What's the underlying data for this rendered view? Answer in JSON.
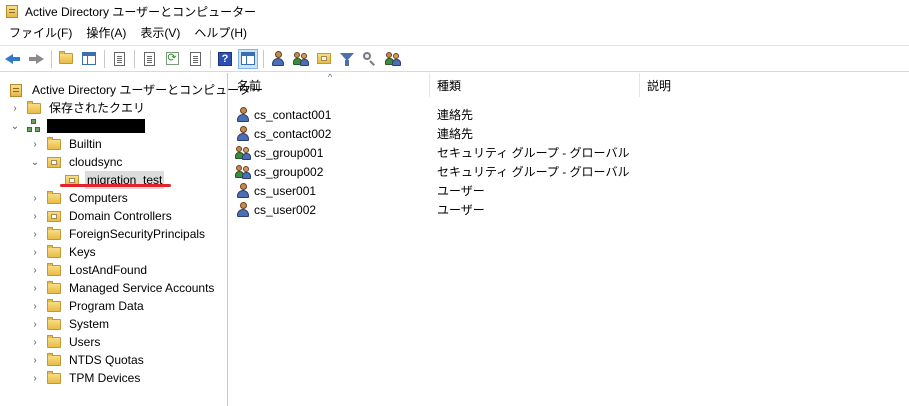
{
  "window": {
    "title": "Active Directory ユーザーとコンピューター"
  },
  "menu": [
    "ファイル(F)",
    "操作(A)",
    "表示(V)",
    "ヘルプ(H)"
  ],
  "toolbar": [
    "back-icon",
    "forward-icon",
    "up-folder-icon",
    "show-hide-tree-icon",
    "properties-icon",
    "export-list-icon",
    "refresh-icon",
    "export-icon",
    "help-icon",
    "action-pane-icon",
    "new-user-icon",
    "new-group-icon",
    "new-ou-icon",
    "filter-icon",
    "find-icon",
    "add-to-group-icon"
  ],
  "tree": {
    "root": "Active Directory ユーザーとコンピューター",
    "saved_queries": "保存されたクエリ",
    "domain_name_redacted": "",
    "items": [
      {
        "label": "Builtin",
        "type": "folder",
        "level": 1
      },
      {
        "label": "cloudsync",
        "type": "ou",
        "level": 1,
        "expanded": true
      },
      {
        "label": "migration_test",
        "type": "ou",
        "level": 2,
        "selected": true
      },
      {
        "label": "Computers",
        "type": "folder",
        "level": 1
      },
      {
        "label": "Domain Controllers",
        "type": "ou",
        "level": 1
      },
      {
        "label": "ForeignSecurityPrincipals",
        "type": "folder",
        "level": 1
      },
      {
        "label": "Keys",
        "type": "folder",
        "level": 1
      },
      {
        "label": "LostAndFound",
        "type": "folder",
        "level": 1
      },
      {
        "label": "Managed Service Accounts",
        "type": "folder",
        "level": 1
      },
      {
        "label": "Program Data",
        "type": "folder",
        "level": 1
      },
      {
        "label": "System",
        "type": "folder",
        "level": 1
      },
      {
        "label": "Users",
        "type": "folder",
        "level": 1
      },
      {
        "label": "NTDS Quotas",
        "type": "folder",
        "level": 1
      },
      {
        "label": "TPM Devices",
        "type": "folder",
        "level": 1
      }
    ]
  },
  "list": {
    "columns": [
      "名前",
      "種類",
      "説明"
    ],
    "rows": [
      {
        "name": "cs_contact001",
        "type": "連絡先",
        "icon": "contact-icon"
      },
      {
        "name": "cs_contact002",
        "type": "連絡先",
        "icon": "contact-icon"
      },
      {
        "name": "cs_group001",
        "type": "セキュリティ グループ - グローバル",
        "icon": "group-icon"
      },
      {
        "name": "cs_group002",
        "type": "セキュリティ グループ - グローバル",
        "icon": "group-icon"
      },
      {
        "name": "cs_user001",
        "type": "ユーザー",
        "icon": "user-icon"
      },
      {
        "name": "cs_user002",
        "type": "ユーザー",
        "icon": "user-icon"
      }
    ]
  },
  "colors": {
    "annotation_underline": "#e3222a",
    "selection": "#dcdcdc"
  }
}
